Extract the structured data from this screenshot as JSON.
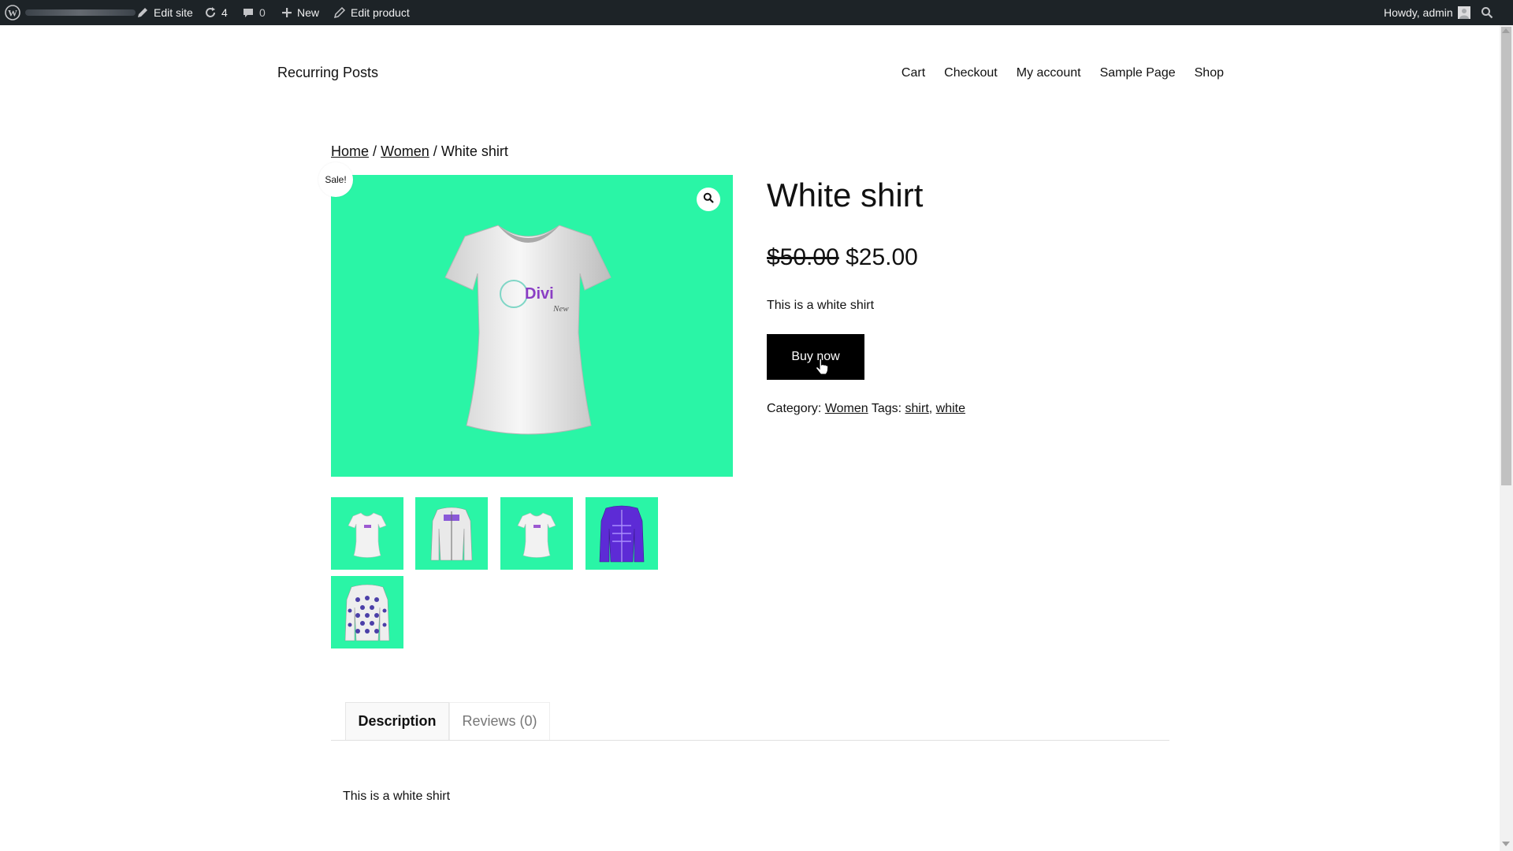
{
  "adminbar": {
    "edit_site": "Edit site",
    "updates_count": "4",
    "comments_count": "0",
    "new_label": "New",
    "edit_product": "Edit product",
    "howdy": "Howdy, admin"
  },
  "header": {
    "site_title": "Recurring Posts",
    "nav": [
      "Cart",
      "Checkout",
      "My account",
      "Sample Page",
      "Shop"
    ]
  },
  "breadcrumb": {
    "home": "Home",
    "sep": "/",
    "category": "Women",
    "current": "White shirt"
  },
  "product": {
    "sale_badge": "Sale!",
    "title": "White shirt",
    "regular_price": "$50.00",
    "sale_price": "$25.00",
    "short_description": "This is a white shirt",
    "buy_button": "Buy now",
    "category_label": "Category:",
    "category": "Women",
    "tags_label": "Tags:",
    "tags": [
      "shirt",
      "white"
    ],
    "logo_text": "Divi",
    "logo_sub": "New"
  },
  "tabs": {
    "description": "Description",
    "reviews": "Reviews (0)"
  },
  "description_body": "This is a white shirt",
  "colors": {
    "accent_green": "#2af5a6",
    "adminbar_bg": "#1d2327",
    "button_bg": "#000000"
  },
  "icons": [
    "wordpress-icon",
    "pencil-icon",
    "refresh-icon",
    "comment-icon",
    "plus-icon",
    "search-icon",
    "magnifier-icon",
    "hand-cursor-icon"
  ]
}
